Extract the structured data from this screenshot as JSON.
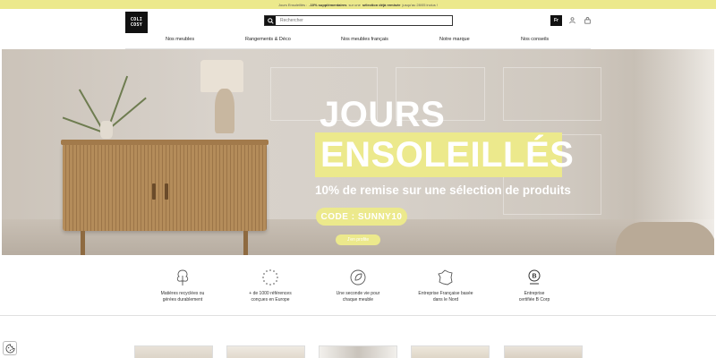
{
  "announcement": {
    "prefix": "Jours Ensoleillés :",
    "bold1": "-10% supplémentaires",
    "middle": "sur une",
    "bold2": "sélection déjà remisée",
    "suffix": "jusqu'au 28/05 inclus !"
  },
  "header": {
    "logo": "COLI COSY",
    "search_placeholder": "Rechercher",
    "language": "Fr"
  },
  "nav": {
    "items": [
      "Nos meubles",
      "Rangements & Déco",
      "Nos meubles français",
      "Notre marque",
      "Nos conseils"
    ]
  },
  "hero": {
    "title_line1": "JOURS",
    "title_line2": "ENSOLEILLÉS",
    "subtitle": "10% de remise sur une sélection de produits",
    "code": "CODE : SUNNY10",
    "cta": "J'en profite"
  },
  "features": [
    {
      "icon": "recycled-tree-icon",
      "line1": "Matières recyclées ou",
      "line2": "gérées durablement"
    },
    {
      "icon": "europe-stars-icon",
      "line1": "+ de 1000 références",
      "line2": "conçues en Europe"
    },
    {
      "icon": "second-life-icon",
      "line1": "Une seconde vie pour",
      "line2": "chaque meuble"
    },
    {
      "icon": "france-map-icon",
      "line1": "Entreprise Française basée",
      "line2": "dans le Nord"
    },
    {
      "icon": "b-corp-icon",
      "line1": "Entreprise",
      "line2": "certifiée B Corp"
    }
  ],
  "colors": {
    "accent": "#ece98c",
    "dark": "#111111"
  }
}
